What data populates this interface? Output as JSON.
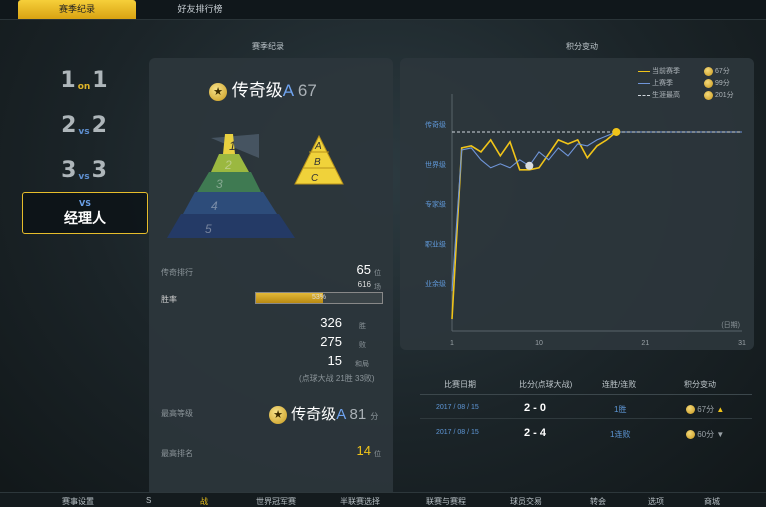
{
  "tabs": {
    "season_record": "赛季纪录",
    "friend_ranking": "好友排行榜"
  },
  "headers": {
    "season_record": "赛季纪录",
    "points_change": "积分变动"
  },
  "modes": {
    "m1": {
      "left": "1",
      "mid": "on",
      "right": "1"
    },
    "m2": {
      "left": "2",
      "mid": "vs",
      "right": "2"
    },
    "m3": {
      "left": "3",
      "mid": "vs",
      "right": "3"
    },
    "m4": {
      "vs": "VS",
      "label": "经理人"
    }
  },
  "rank": {
    "icon": "star-coin-icon",
    "name": "传奇级",
    "grade": "A",
    "points": "67"
  },
  "pyramid_left": [
    "1",
    "2",
    "3",
    "4",
    "5"
  ],
  "pyramid_right": [
    "A",
    "B",
    "C"
  ],
  "stats": {
    "ranking_label": "传奇排行",
    "ranking_value": "65",
    "ranking_unit": "位",
    "ranking_sub": "616",
    "ranking_sub_unit": "场",
    "winrate_label": "胜率",
    "winrate_text": "53%",
    "winrate_fraction": 0.53,
    "wins": "326",
    "wins_unit": "胜",
    "losses": "275",
    "losses_unit": "败",
    "draws": "15",
    "draws_unit": "和局",
    "note": "(点球大战 21胜 33败)",
    "highest_grade_label": "最高等级",
    "highest_grade_name": "传奇级",
    "highest_grade_grade": "A",
    "highest_grade_points": "81",
    "highest_grade_unit": "分",
    "highest_rank_label": "最高排名",
    "highest_rank_value": "14",
    "highest_rank_unit": "位"
  },
  "legend": [
    {
      "label": "当前赛季",
      "value": "67分",
      "color": "#f0c419"
    },
    {
      "label": "上赛季",
      "value": "99分",
      "color": "#6f95d8"
    },
    {
      "label": "生涯最高",
      "value": "201分",
      "color": "#cfd6dc"
    }
  ],
  "chart_data": {
    "type": "line",
    "y_categories": [
      "传奇级",
      "世界级",
      "专家级",
      "职业级",
      "业余级"
    ],
    "x_ticks": [
      "1",
      "10",
      "21",
      "31"
    ],
    "x_unit": "(日期)",
    "xlim": [
      1,
      31
    ],
    "series": [
      {
        "name": "当前赛季",
        "color": "#f0c419",
        "points": [
          [
            1,
            -0.5
          ],
          [
            2,
            3.8
          ],
          [
            3,
            3.85
          ],
          [
            4,
            3.7
          ],
          [
            5,
            4.0
          ],
          [
            6,
            3.6
          ],
          [
            7,
            3.95
          ],
          [
            8,
            3.25
          ],
          [
            9,
            3.25
          ],
          [
            10,
            3.3
          ],
          [
            11,
            3.65
          ],
          [
            12,
            4.0
          ],
          [
            13,
            3.9
          ],
          [
            14,
            4.0
          ],
          [
            15,
            3.55
          ],
          [
            16,
            3.85
          ],
          [
            17,
            4.0
          ],
          [
            18,
            4.2
          ]
        ]
      },
      {
        "name": "上赛季",
        "color": "#6f95d8",
        "points": [
          [
            1,
            0.2
          ],
          [
            2,
            3.75
          ],
          [
            3,
            3.8
          ],
          [
            4,
            3.5
          ],
          [
            5,
            3.3
          ],
          [
            6,
            3.4
          ],
          [
            7,
            3.3
          ],
          [
            8,
            3.5
          ],
          [
            9,
            3.35
          ],
          [
            10,
            3.7
          ],
          [
            11,
            3.5
          ],
          [
            12,
            3.8
          ],
          [
            13,
            3.6
          ],
          [
            14,
            3.9
          ],
          [
            15,
            3.85
          ],
          [
            16,
            4.0
          ],
          [
            17,
            4.1
          ],
          [
            18,
            4.2
          ],
          [
            31,
            4.2
          ]
        ]
      },
      {
        "name": "生涯最高",
        "color": "#cfd6dc",
        "points": [
          [
            1,
            4.2
          ],
          [
            31,
            4.2
          ]
        ]
      }
    ]
  },
  "table": {
    "headers": [
      "比赛日期",
      "比分(点球大战)",
      "连胜/连败",
      "积分变动"
    ],
    "rows": [
      {
        "date": "2017 / 08 / 15",
        "score": "2 - 0",
        "streak": "1胜",
        "points": "67分",
        "trend": "up"
      },
      {
        "date": "2017 / 08 / 15",
        "score": "2 - 4",
        "streak": "1连败",
        "points": "60分",
        "trend": "down"
      }
    ]
  },
  "bottom_menu": [
    "赛事设置",
    "S",
    "战",
    "世界冠军赛",
    "半联赛选择",
    "联赛与赛程",
    "球员交易",
    "转会",
    "选项",
    "商城"
  ]
}
